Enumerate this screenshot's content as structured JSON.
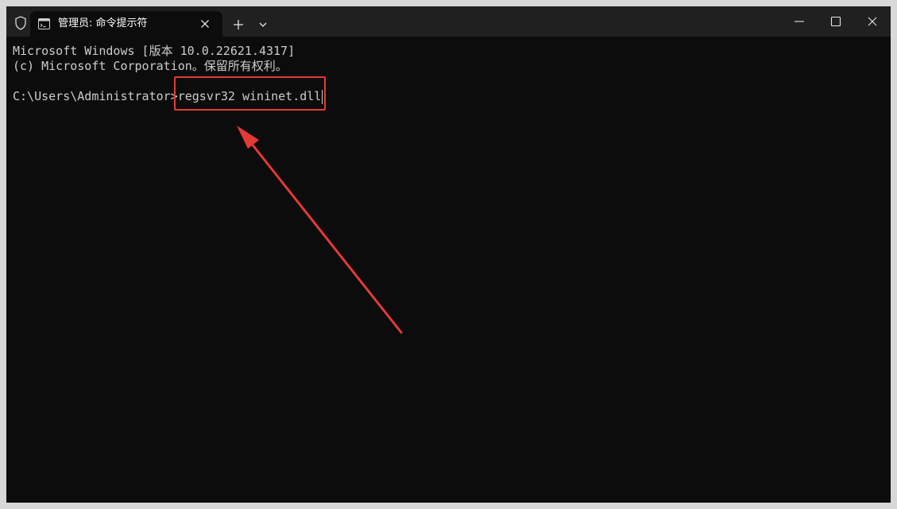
{
  "window": {
    "tab_title": "管理员: 命令提示符",
    "icons": {
      "shield": "shield-icon",
      "tab": "cmd-icon",
      "tab_close": "close-icon",
      "new_tab": "plus-icon",
      "dropdown": "chevron-down-icon",
      "minimize": "minimize-icon",
      "maximize": "maximize-icon",
      "close": "close-icon"
    }
  },
  "console": {
    "lines": [
      "Microsoft Windows [版本 10.0.22621.4317]",
      "(c) Microsoft Corporation。保留所有权利。"
    ],
    "prompt": "C:\\Users\\Administrator>",
    "command": "regsvr32 wininet.dll"
  },
  "colors": {
    "background": "#0c0c0c",
    "titlebar": "#202020",
    "text": "#cccccc",
    "annotation": "#e53935"
  }
}
